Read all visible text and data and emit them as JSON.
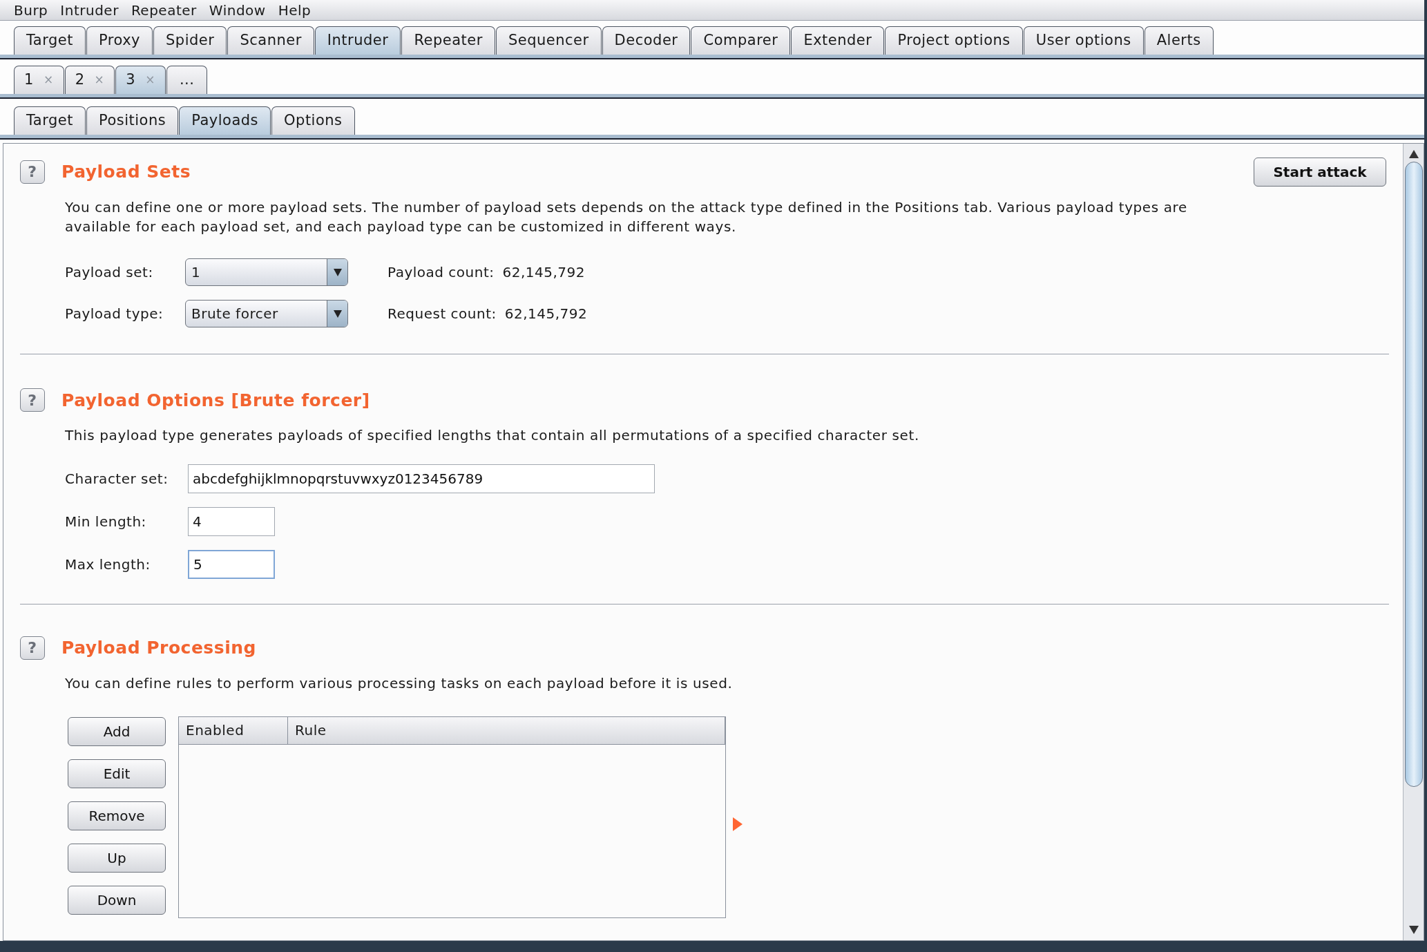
{
  "menu": [
    "Burp",
    "Intruder",
    "Repeater",
    "Window",
    "Help"
  ],
  "main_tabs": [
    {
      "label": "Target",
      "selected": false
    },
    {
      "label": "Proxy",
      "selected": false
    },
    {
      "label": "Spider",
      "selected": false
    },
    {
      "label": "Scanner",
      "selected": false
    },
    {
      "label": "Intruder",
      "selected": true
    },
    {
      "label": "Repeater",
      "selected": false
    },
    {
      "label": "Sequencer",
      "selected": false
    },
    {
      "label": "Decoder",
      "selected": false
    },
    {
      "label": "Comparer",
      "selected": false
    },
    {
      "label": "Extender",
      "selected": false
    },
    {
      "label": "Project options",
      "selected": false
    },
    {
      "label": "User options",
      "selected": false
    },
    {
      "label": "Alerts",
      "selected": false
    }
  ],
  "attack_tabs": [
    {
      "kind": "attack",
      "label": "1",
      "close": "×",
      "selected": false
    },
    {
      "kind": "attack",
      "label": "2",
      "close": "×",
      "selected": false
    },
    {
      "kind": "attack",
      "label": "3",
      "close": "×",
      "selected": true
    },
    {
      "kind": "new",
      "label": "...",
      "selected": false
    }
  ],
  "sub_tabs": [
    {
      "label": "Target",
      "selected": false
    },
    {
      "label": "Positions",
      "selected": false
    },
    {
      "label": "Payloads",
      "selected": true
    },
    {
      "label": "Options",
      "selected": false
    }
  ],
  "payload_sets": {
    "help": "?",
    "title": "Payload Sets",
    "description": "You can define one or more payload sets. The number of payload sets depends on the attack type defined in the Positions tab. Various payload types are available for each payload set, and each payload type can be customized in different ways.",
    "start_button": "Start attack",
    "rows": [
      {
        "label": "Payload set:",
        "value": "1",
        "count_label": "Payload count:",
        "count": "62,145,792"
      },
      {
        "label": "Payload type:",
        "value": "Brute forcer",
        "count_label": "Request count:",
        "count": "62,145,792"
      }
    ]
  },
  "payload_options": {
    "help": "?",
    "title": "Payload Options [Brute forcer]",
    "description": "This payload type generates payloads of specified lengths that contain all permutations of a specified character set.",
    "fields": [
      {
        "kind": "wide",
        "label": "Character set:",
        "value": "abcdefghijklmnopqrstuvwxyz0123456789",
        "focused": false
      },
      {
        "kind": "short",
        "label": "Min length:",
        "value": "4",
        "focused": false
      },
      {
        "kind": "short",
        "label": "Max length:",
        "value": "5",
        "focused": true
      }
    ]
  },
  "payload_processing": {
    "help": "?",
    "title": "Payload Processing",
    "description": "You can define rules to perform various processing tasks on each payload before it is used.",
    "buttons": [
      "Add",
      "Edit",
      "Remove",
      "Up",
      "Down"
    ],
    "table": {
      "columns": [
        "Enabled",
        "Rule"
      ]
    }
  }
}
